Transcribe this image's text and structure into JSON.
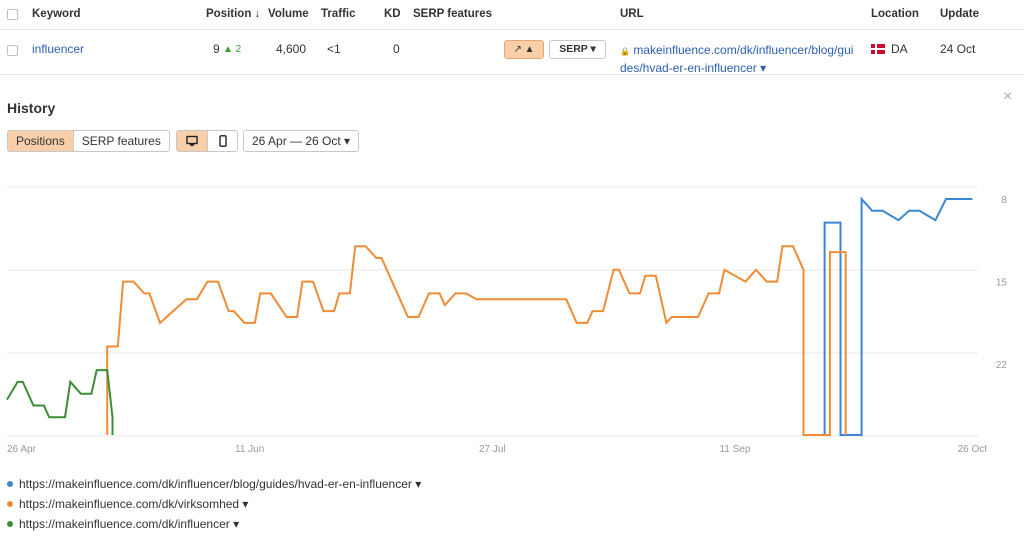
{
  "table": {
    "headers": {
      "keyword": "Keyword",
      "position": "Position ↓",
      "volume": "Volume",
      "traffic": "Traffic",
      "kd": "KD",
      "serp": "SERP features",
      "url": "URL",
      "location": "Location",
      "update": "Update"
    },
    "row": {
      "keyword": "influencer",
      "position": "9",
      "position_change": "▲ 2",
      "volume": "4,600",
      "traffic": "<1",
      "kd": "0",
      "trend_button": "↗ ▲",
      "serp_button": "SERP ▾",
      "url_lock": "🔒",
      "url": "makeinfluence.com/dk/influencer/blog/guides/hvad-er-en-influencer ▾",
      "location": "DA",
      "update": "24 Oct"
    }
  },
  "history": {
    "title": "History",
    "close": "×",
    "tabs": [
      "Positions",
      "SERP features"
    ],
    "date_range": "26 Apr — 26 Oct ▾"
  },
  "chart_data": {
    "type": "line",
    "y_axis": {
      "ticks": [
        "8",
        "15",
        "22"
      ]
    },
    "x_axis": {
      "ticks": [
        "26 Apr",
        "11 Jun",
        "27 Jul",
        "11 Sep",
        "26 Oct"
      ]
    },
    "series": [
      {
        "name": "https://makeinfluence.com/dk/influencer/blog/guides/hvad-er-en-influencer",
        "color": "#3b86d4",
        "x": [
          "2023-09-28",
          "2023-09-28",
          "2023-10-01",
          "2023-10-01",
          "2023-10-05",
          "2023-10-05",
          "2023-10-07",
          "2023-10-09",
          "2023-10-12",
          "2023-10-14",
          "2023-10-16",
          "2023-10-19",
          "2023-10-21",
          "2023-10-23",
          "2023-10-26"
        ],
        "y": [
          28,
          10,
          10,
          28,
          28,
          8,
          9,
          9,
          9.8,
          9,
          9,
          9.8,
          8,
          8,
          8
        ]
      },
      {
        "name": "https://makeinfluence.com/dk/virksomhed",
        "color": "#f08c36",
        "x": [
          "2023-05-15",
          "2023-05-15",
          "2023-05-17",
          "2023-05-18",
          "2023-05-20",
          "2023-05-22",
          "2023-05-23",
          "2023-05-25",
          "2023-05-30",
          "2023-06-01",
          "2023-06-03",
          "2023-06-05",
          "2023-06-07",
          "2023-06-08",
          "2023-06-10",
          "2023-06-12",
          "2023-06-13",
          "2023-06-15",
          "2023-06-18",
          "2023-06-20",
          "2023-06-21",
          "2023-06-23",
          "2023-06-25",
          "2023-06-27",
          "2023-06-28",
          "2023-06-30",
          "2023-07-01",
          "2023-07-03",
          "2023-07-05",
          "2023-07-06",
          "2023-07-11",
          "2023-07-13",
          "2023-07-15",
          "2023-07-17",
          "2023-07-18",
          "2023-07-20",
          "2023-07-22",
          "2023-07-24",
          "2023-08-10",
          "2023-08-12",
          "2023-08-14",
          "2023-08-15",
          "2023-08-17",
          "2023-08-19",
          "2023-08-20",
          "2023-08-22",
          "2023-08-24",
          "2023-08-25",
          "2023-08-27",
          "2023-08-29",
          "2023-08-30",
          "2023-09-04",
          "2023-09-06",
          "2023-09-08",
          "2023-09-09",
          "2023-09-11",
          "2023-09-13",
          "2023-09-15",
          "2023-09-17",
          "2023-09-19",
          "2023-09-20",
          "2023-09-22",
          "2023-09-24",
          "2023-09-24",
          "2023-09-29",
          "2023-09-29",
          "2023-10-02",
          "2023-10-02"
        ],
        "y": [
          28,
          20.5,
          20.5,
          15,
          15,
          16,
          16,
          18.5,
          16.5,
          16.5,
          15,
          15,
          17.5,
          17.5,
          18.5,
          18.5,
          16,
          16,
          18,
          18,
          15,
          15,
          17.5,
          17.5,
          16,
          16,
          12,
          12,
          13,
          13,
          18,
          18,
          16,
          16,
          17,
          16,
          16,
          16.5,
          16.5,
          18.5,
          18.5,
          17.5,
          17.5,
          14,
          14,
          16,
          16,
          14.5,
          14.5,
          18.5,
          18,
          18,
          16,
          16,
          14,
          14.5,
          15,
          14,
          15,
          15,
          12,
          12,
          14,
          28,
          28,
          12.5,
          12.5,
          28
        ]
      },
      {
        "name": "https://makeinfluence.com/dk/influencer",
        "color": "#3d8c36",
        "x": [
          "2023-04-26",
          "2023-04-28",
          "2023-04-29",
          "2023-05-01",
          "2023-05-03",
          "2023-05-04",
          "2023-05-07",
          "2023-05-08",
          "2023-05-10",
          "2023-05-12",
          "2023-05-13",
          "2023-05-15",
          "2023-05-16",
          "2023-05-16"
        ],
        "y": [
          25,
          23.5,
          23.5,
          25.5,
          25.5,
          26.5,
          26.5,
          23.5,
          24.5,
          24.5,
          22.5,
          22.5,
          26.5,
          28
        ]
      }
    ]
  },
  "legend": [
    {
      "label": "https://makeinfluence.com/dk/influencer/blog/guides/hvad-er-en-influencer ▾",
      "color": "#3b86d4"
    },
    {
      "label": "https://makeinfluence.com/dk/virksomhed ▾",
      "color": "#f08c36"
    },
    {
      "label": "https://makeinfluence.com/dk/influencer ▾",
      "color": "#3d8c36"
    }
  ]
}
